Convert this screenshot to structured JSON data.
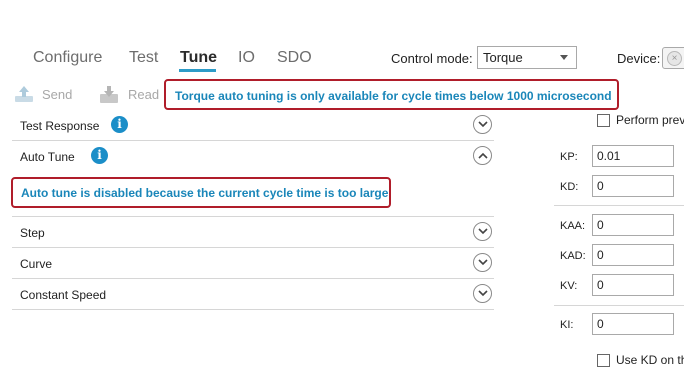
{
  "tabs": [
    {
      "label": "Configure"
    },
    {
      "label": "Test"
    },
    {
      "label": "Tune",
      "active": true
    },
    {
      "label": "IO"
    },
    {
      "label": "SDO"
    }
  ],
  "control_mode": {
    "label": "Control mode:",
    "value": "Torque"
  },
  "device": {
    "label": "Device:"
  },
  "toolbar": {
    "send_label": "Send",
    "read_label": "Read"
  },
  "banners": {
    "top": "Torque auto tuning is only available for cycle times below 1000 microsecond",
    "auto_tune": "Auto tune is disabled because the current cycle time is too large"
  },
  "accordion": [
    {
      "label": "Test Response",
      "info": true,
      "expanded": false
    },
    {
      "label": "Auto Tune",
      "info": true,
      "expanded": true
    },
    {
      "label": "Step",
      "info": false,
      "expanded": false
    },
    {
      "label": "Curve",
      "info": false,
      "expanded": false
    },
    {
      "label": "Constant Speed",
      "info": false,
      "expanded": false
    }
  ],
  "right_panel": {
    "perform_label": "Perform prev",
    "params": [
      {
        "label": "KP:",
        "value": "0.01"
      },
      {
        "label": "KD:",
        "value": "0"
      },
      {
        "label": "KAA:",
        "value": "0"
      },
      {
        "label": "KAD:",
        "value": "0"
      },
      {
        "label": "KV:",
        "value": "0"
      },
      {
        "label": "KI:",
        "value": "0"
      }
    ],
    "use_kd_label": "Use KD on th"
  },
  "colors": {
    "accent": "#2d9cc8",
    "banner_border": "#b01d2a",
    "banner_text": "#1a86b9",
    "info": "#1b8ec8"
  },
  "icons": {
    "send": "send-icon",
    "read": "read-icon",
    "info": "info-icon",
    "chevron_down": "chevron-down-icon",
    "chevron_up": "chevron-up-icon"
  }
}
